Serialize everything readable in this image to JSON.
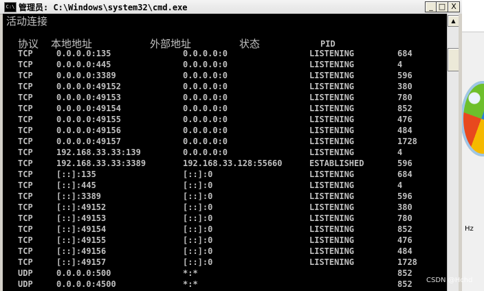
{
  "window": {
    "title": "管理员: C:\\Windows\\system32\\cmd.exe",
    "icon_text": "C:\\",
    "buttons": {
      "minimize": "_",
      "maximize": "□",
      "close": "X"
    }
  },
  "console": {
    "header": "活动连接",
    "columns": {
      "proto": "协议",
      "local": "本地地址",
      "foreign": "外部地址",
      "state": "状态",
      "pid": "PID"
    },
    "rows": [
      {
        "proto": "TCP",
        "local": "0.0.0.0:135",
        "foreign": "0.0.0.0:0",
        "state": "LISTENING",
        "pid": "684"
      },
      {
        "proto": "TCP",
        "local": "0.0.0.0:445",
        "foreign": "0.0.0.0:0",
        "state": "LISTENING",
        "pid": "4"
      },
      {
        "proto": "TCP",
        "local": "0.0.0.0:3389",
        "foreign": "0.0.0.0:0",
        "state": "LISTENING",
        "pid": "596"
      },
      {
        "proto": "TCP",
        "local": "0.0.0.0:49152",
        "foreign": "0.0.0.0:0",
        "state": "LISTENING",
        "pid": "380"
      },
      {
        "proto": "TCP",
        "local": "0.0.0.0:49153",
        "foreign": "0.0.0.0:0",
        "state": "LISTENING",
        "pid": "780"
      },
      {
        "proto": "TCP",
        "local": "0.0.0.0:49154",
        "foreign": "0.0.0.0:0",
        "state": "LISTENING",
        "pid": "852"
      },
      {
        "proto": "TCP",
        "local": "0.0.0.0:49155",
        "foreign": "0.0.0.0:0",
        "state": "LISTENING",
        "pid": "476"
      },
      {
        "proto": "TCP",
        "local": "0.0.0.0:49156",
        "foreign": "0.0.0.0:0",
        "state": "LISTENING",
        "pid": "484"
      },
      {
        "proto": "TCP",
        "local": "0.0.0.0:49157",
        "foreign": "0.0.0.0:0",
        "state": "LISTENING",
        "pid": "1728"
      },
      {
        "proto": "TCP",
        "local": "192.168.33.33:139",
        "foreign": "0.0.0.0:0",
        "state": "LISTENING",
        "pid": "4"
      },
      {
        "proto": "TCP",
        "local": "192.168.33.33:3389",
        "foreign": "192.168.33.128:55660",
        "state": "ESTABLISHED",
        "pid": "596"
      },
      {
        "proto": "TCP",
        "local": "[::]:135",
        "foreign": "[::]:0",
        "state": "LISTENING",
        "pid": "684"
      },
      {
        "proto": "TCP",
        "local": "[::]:445",
        "foreign": "[::]:0",
        "state": "LISTENING",
        "pid": "4"
      },
      {
        "proto": "TCP",
        "local": "[::]:3389",
        "foreign": "[::]:0",
        "state": "LISTENING",
        "pid": "596"
      },
      {
        "proto": "TCP",
        "local": "[::]:49152",
        "foreign": "[::]:0",
        "state": "LISTENING",
        "pid": "380"
      },
      {
        "proto": "TCP",
        "local": "[::]:49153",
        "foreign": "[::]:0",
        "state": "LISTENING",
        "pid": "780"
      },
      {
        "proto": "TCP",
        "local": "[::]:49154",
        "foreign": "[::]:0",
        "state": "LISTENING",
        "pid": "852"
      },
      {
        "proto": "TCP",
        "local": "[::]:49155",
        "foreign": "[::]:0",
        "state": "LISTENING",
        "pid": "476"
      },
      {
        "proto": "TCP",
        "local": "[::]:49156",
        "foreign": "[::]:0",
        "state": "LISTENING",
        "pid": "484"
      },
      {
        "proto": "TCP",
        "local": "[::]:49157",
        "foreign": "[::]:0",
        "state": "LISTENING",
        "pid": "1728"
      },
      {
        "proto": "UDP",
        "local": "0.0.0.0:500",
        "foreign": "*:*",
        "state": "",
        "pid": "852"
      },
      {
        "proto": "UDP",
        "local": "0.0.0.0:4500",
        "foreign": "*:*",
        "state": "",
        "pid": "852"
      }
    ]
  },
  "scrollbar": {
    "up_arrow": "▲"
  },
  "background": {
    "side_text": "Hz"
  },
  "watermark": "CSDN @Hchd",
  "colors": {
    "console_bg": "#000000",
    "console_fg": "#c0c0c0"
  }
}
